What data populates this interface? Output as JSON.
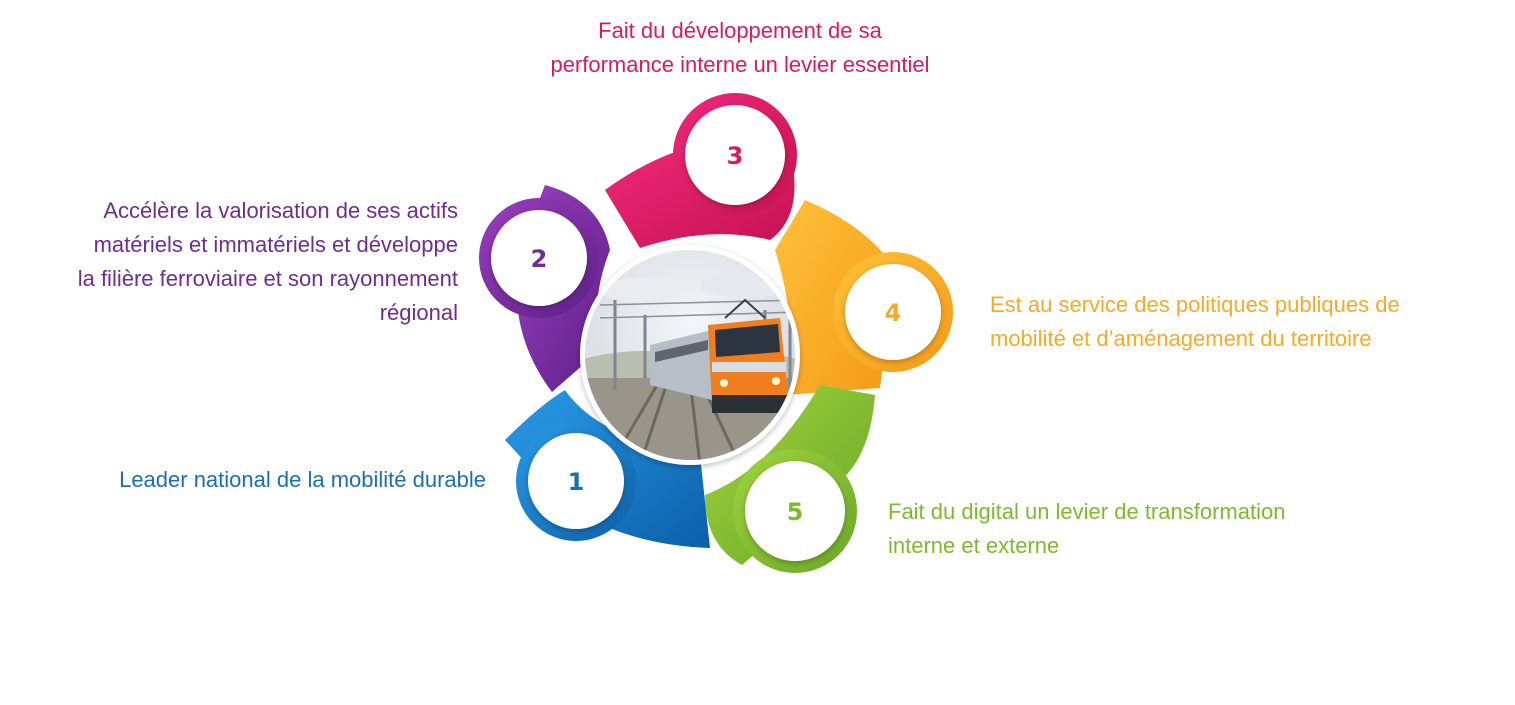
{
  "steps": [
    {
      "number": "1",
      "color": "#1577c5",
      "text": [
        "Leader national de la mobilité durable"
      ]
    },
    {
      "number": "2",
      "color": "#7b2d9e",
      "text": [
        "Accélère la valorisation de ses actifs",
        "matériels et immatériels et développe",
        "la filière ferroviaire et son rayonnement",
        "régional"
      ]
    },
    {
      "number": "3",
      "color": "#e0185f",
      "text": [
        "Fait du développement de sa",
        "performance interne un levier essentiel"
      ]
    },
    {
      "number": "4",
      "color": "#f7ac2a",
      "text": [
        "Est au service des politiques publiques de",
        "mobilité et d’aménagement du territoire"
      ]
    },
    {
      "number": "5",
      "color": "#86c232",
      "text": [
        "Fait du digital un levier de transformation",
        "interne et externe"
      ]
    }
  ],
  "center_image": "train-photo",
  "colors": {
    "text1": "#1a6fb6",
    "text2": "#6f2c91",
    "text3": "#d81b60",
    "text4": "#f7a928",
    "text5": "#7cbb2c"
  }
}
